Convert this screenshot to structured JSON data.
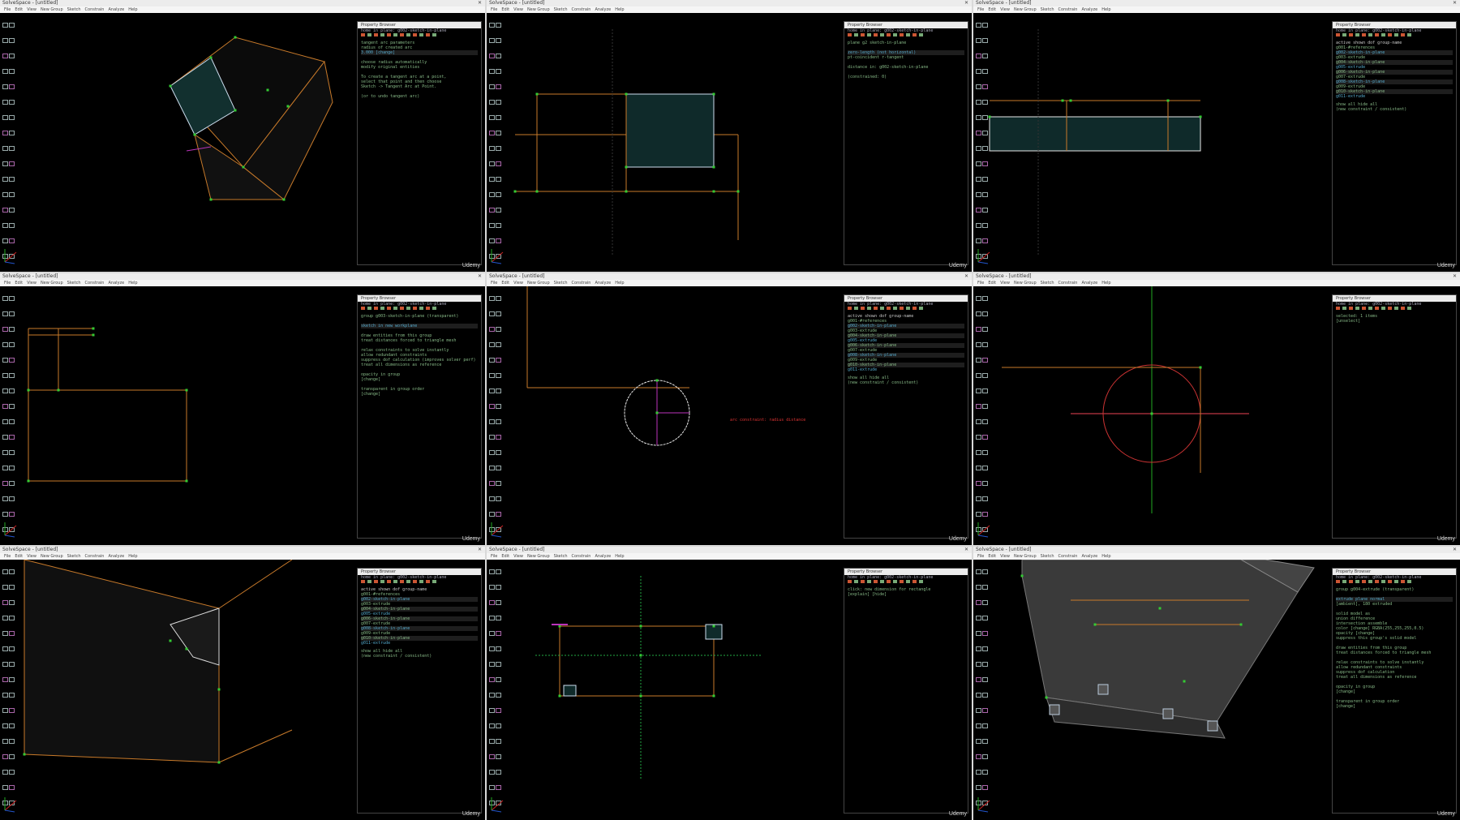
{
  "app": {
    "window_title": "SolveSpace - [untitled]",
    "watermark": "Udemy"
  },
  "menu": [
    "File",
    "Edit",
    "View",
    "New Group",
    "Sketch",
    "Constrain",
    "Analyze",
    "Help"
  ],
  "panel": {
    "title": "Property Browser",
    "nav": "home   in plane: g002-sketch-in-plane",
    "group_list_header": "active  shown  dof  group-name",
    "groups": [
      "g001-#references",
      "g002-sketch-in-plane",
      "g003-extrude",
      "g004-sketch-in-plane",
      "g005-extrude",
      "g006-sketch-in-plane",
      "g007-extrude",
      "g008-sketch-in-plane",
      "g009-extrude",
      "g010-sketch-in-plane",
      "g011-extrude"
    ],
    "show_all": "show all  hide all",
    "constraint_line": "(new constraint / consistent)"
  },
  "cells": [
    {
      "panel_lines": [
        "tangent arc parameters",
        "radius of created arc",
        "   3.000 [change]",
        "",
        "choose radius automatically",
        "modify original entities",
        "",
        "To create a tangent arc at a point,",
        "select that point and then choose",
        "Sketch -> Tangent Arc at Point.",
        "",
        "(or to undo tangent arc)"
      ]
    },
    {
      "panel_lines": [
        "plane  g2  sketch-in-plane",
        "",
        "zero-length   (not horizontal)",
        "pt-coincident   r-tangent",
        "",
        "distance in:  g002-sketch-in-plane",
        "",
        "(constrained: 0)"
      ]
    },
    {
      "panel_lines": []
    },
    {
      "panel_lines": [
        "group  g003-sketch-in-plane  (transparent)",
        "",
        "sketch in new workplane",
        "",
        "draw entities from this group",
        "treat distances forced to triangle mesh",
        "",
        "relax constraints to solve instantly",
        "allow redundant constraints",
        "suppress dof calculation (improves solver perf)",
        "treat all dimensions as reference",
        "",
        "opacity in group",
        "   [change]",
        "",
        "transparent in group order",
        "   [change]"
      ]
    },
    {
      "panel_lines": [],
      "label": "arc constraint: radius distance"
    },
    {
      "panel_lines": [
        "selected: 1 items",
        "   [unselect]"
      ]
    },
    {
      "panel_lines": []
    },
    {
      "panel_lines": [
        "click: new dimension for rectangle",
        "   [explain] [hide]"
      ]
    },
    {
      "panel_lines": [
        "group  g004-extrude  (transparent)",
        "",
        "extrude plane normal",
        "   [ambient], 180 extruded",
        "",
        "solid model as",
        "   union    difference",
        "   intersection  assemble",
        "   color  [change] RGBA(255,255,255,0.5)",
        "   opacity  [change]",
        "   suppress this group's solid model",
        "",
        "draw entities from this group",
        "treat distances forced to triangle mesh",
        "",
        "relax constraints to solve instantly",
        "allow redundant constraints",
        "suppress dof calculation",
        "treat all dimensions as reference",
        "",
        "opacity in group",
        "   [change]",
        "",
        "transparent in group order",
        "   [change]"
      ]
    }
  ]
}
